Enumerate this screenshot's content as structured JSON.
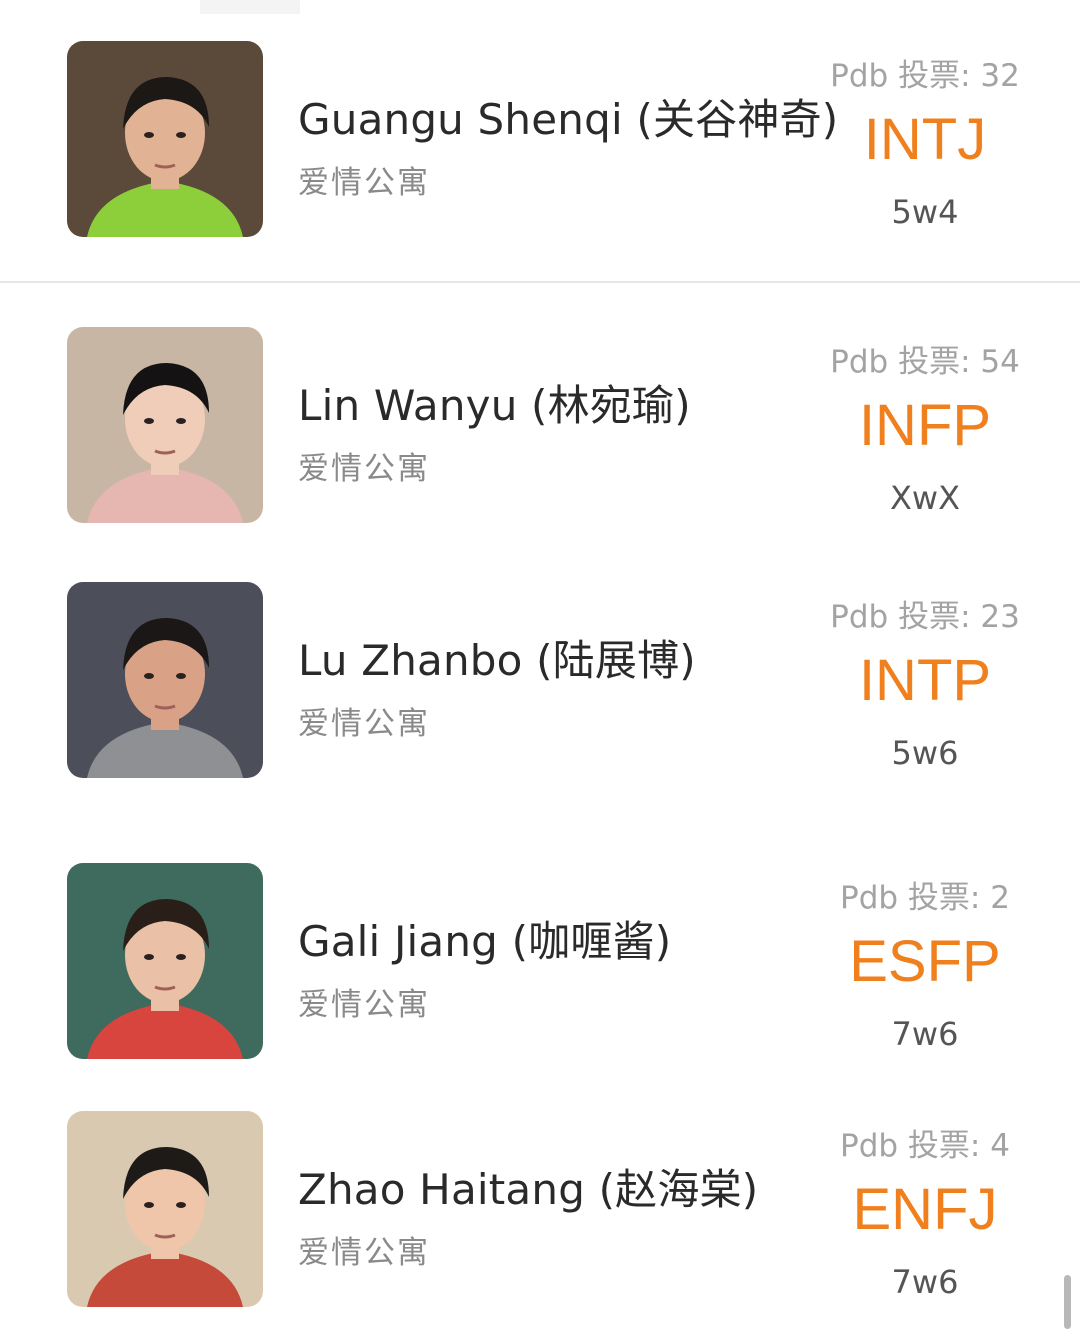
{
  "characters": [
    {
      "name": "Guangu Shenqi (关谷神奇)",
      "show": "爱情公寓",
      "votes": "Pdb 投票: 32",
      "mbti": "INTJ",
      "enneagram": "5w4",
      "avatar_colors": {
        "bg": "#5b4a3a",
        "skin": "#e2b294",
        "hair": "#1c1816",
        "shirt": "#8ccf3a"
      }
    },
    {
      "name": "Lin Wanyu (林宛瑜)",
      "show": "爱情公寓",
      "votes": "Pdb 投票: 54",
      "mbti": "INFP",
      "enneagram": "XwX",
      "avatar_colors": {
        "bg": "#c8b6a4",
        "skin": "#f0cdb8",
        "hair": "#141212",
        "shirt": "#e6b6b0"
      }
    },
    {
      "name": "Lu Zhanbo (陆展博)",
      "show": "爱情公寓",
      "votes": "Pdb 投票: 23",
      "mbti": "INTP",
      "enneagram": "5w6",
      "avatar_colors": {
        "bg": "#4c4e5a",
        "skin": "#d9a286",
        "hair": "#1a1716",
        "shirt": "#8e9094"
      }
    },
    {
      "name": "Gali Jiang (咖喱酱)",
      "show": "爱情公寓",
      "votes": "Pdb 投票: 2",
      "mbti": "ESFP",
      "enneagram": "7w6",
      "avatar_colors": {
        "bg": "#3f6a5e",
        "skin": "#eac0a6",
        "hair": "#2a1e18",
        "shirt": "#d8443e"
      }
    },
    {
      "name": "Zhao Haitang (赵海棠)",
      "show": "爱情公寓",
      "votes": "Pdb 投票: 4",
      "mbti": "ENFJ",
      "enneagram": "7w6",
      "avatar_colors": {
        "bg": "#d9c9b0",
        "skin": "#efc6aa",
        "hair": "#1e1a18",
        "shirt": "#c64a3a"
      }
    }
  ]
}
